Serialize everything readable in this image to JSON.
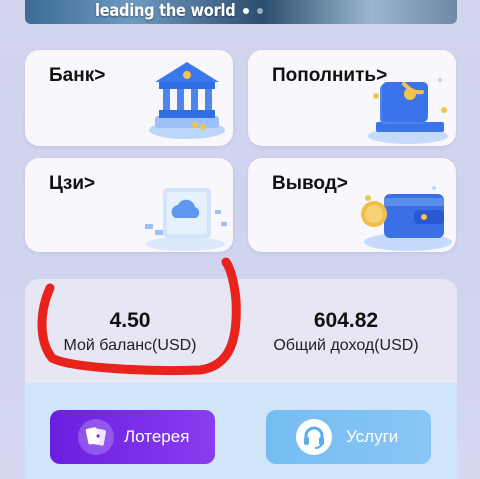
{
  "banner": {
    "text": "leading the world"
  },
  "cards": {
    "bank": {
      "label": "Банк>",
      "icon": "bank-building-icon"
    },
    "topup": {
      "label": "Пополнить>",
      "icon": "wallet-topup-icon"
    },
    "czi": {
      "label": "Цзи>",
      "icon": "cloud-storage-icon"
    },
    "withdraw": {
      "label": "Вывод>",
      "icon": "wallet-withdraw-icon"
    }
  },
  "balance": {
    "my_balance_value": "4.50",
    "my_balance_label": "Мой баланс(USD)",
    "total_income_value": "604.82",
    "total_income_label": "Общий доход(USD)"
  },
  "actions": {
    "lottery_label": "Лотерея",
    "lottery_icon": "cards-icon",
    "service_label": "Услуги",
    "service_icon": "headset-icon"
  },
  "colors": {
    "annotation": "#e8231b",
    "lottery_button": "#7a2ee8",
    "service_button": "#7ec0f3"
  }
}
